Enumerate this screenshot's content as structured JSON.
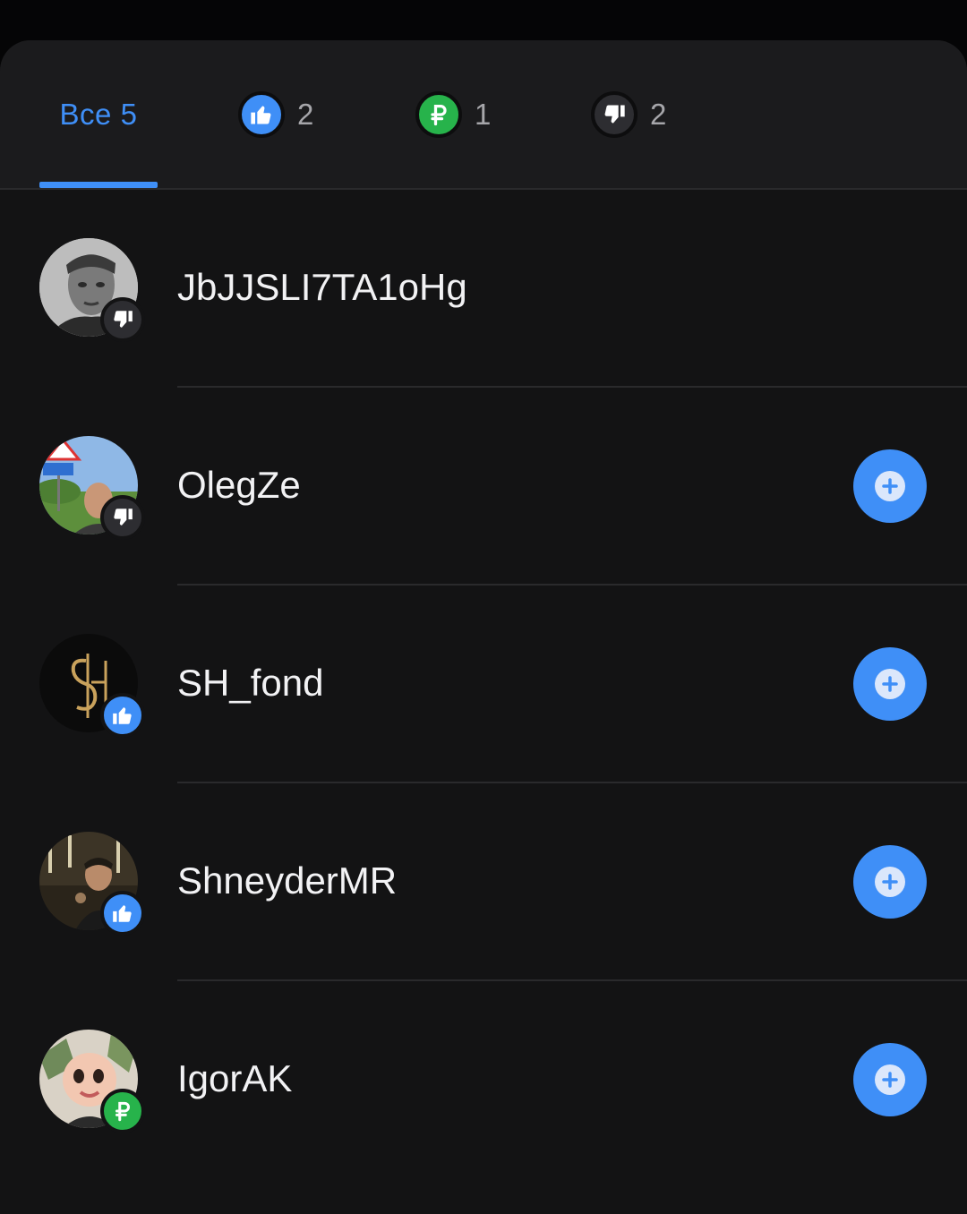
{
  "tabs": {
    "all_label": "Все 5",
    "like_count": "2",
    "ruble_count": "1",
    "dislike_count": "2"
  },
  "users": [
    {
      "name": "JbJJSLI7TA1oHg",
      "reaction": "thumbs-down-icon",
      "has_follow": false
    },
    {
      "name": "OlegZe",
      "reaction": "thumbs-down-icon",
      "has_follow": true
    },
    {
      "name": "SH_fond",
      "reaction": "thumbs-up-icon",
      "has_follow": true
    },
    {
      "name": "ShneyderMR",
      "reaction": "thumbs-up-icon",
      "has_follow": true
    },
    {
      "name": "IgorAK",
      "reaction": "ruble-icon",
      "has_follow": true
    }
  ],
  "colors": {
    "accent": "#3f8ff7",
    "ruble": "#27b34b",
    "dislike": "#2d2d31",
    "background": "#131314"
  }
}
